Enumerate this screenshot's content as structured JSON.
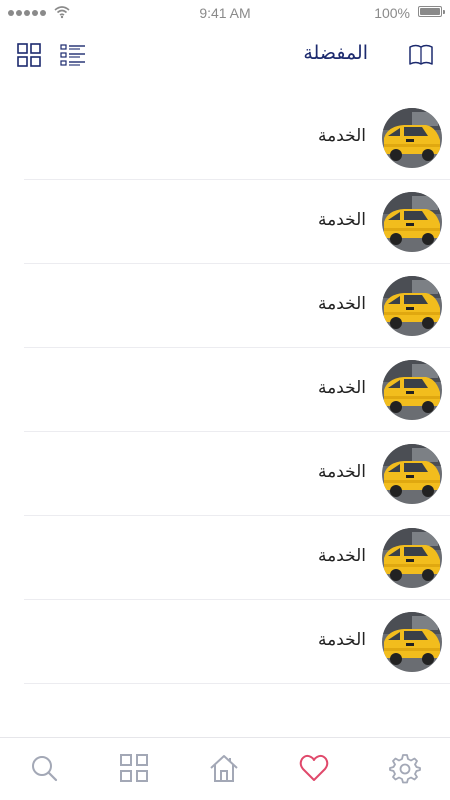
{
  "status_bar": {
    "time": "9:41 AM",
    "battery": "100%"
  },
  "header": {
    "title": "المفضلة",
    "icons": {
      "left1": "grid-view-icon",
      "left2": "list-view-icon",
      "right": "book-icon"
    }
  },
  "favorites": [
    {
      "label": "الخدمة",
      "image": "taxi-avatar"
    },
    {
      "label": "الخدمة",
      "image": "taxi-avatar"
    },
    {
      "label": "الخدمة",
      "image": "taxi-avatar"
    },
    {
      "label": "الخدمة",
      "image": "taxi-avatar"
    },
    {
      "label": "الخدمة",
      "image": "taxi-avatar"
    },
    {
      "label": "الخدمة",
      "image": "taxi-avatar"
    },
    {
      "label": "الخدمة",
      "image": "taxi-avatar"
    }
  ],
  "tab_bar": {
    "tabs": [
      "search-icon",
      "grid-icon",
      "home-icon",
      "heart-icon",
      "settings-icon"
    ],
    "active": "heart-icon"
  },
  "colors": {
    "accent": "#e0496b",
    "title": "#1c2a6e",
    "icon": "#a3a8b6"
  }
}
